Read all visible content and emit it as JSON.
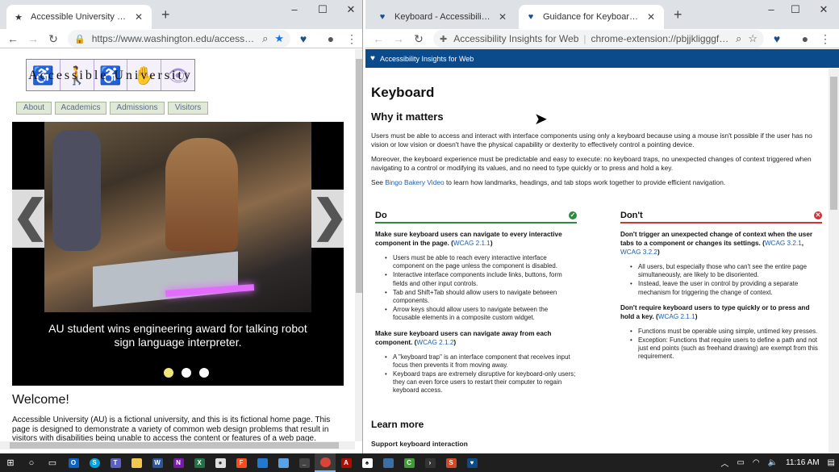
{
  "left_window": {
    "tab_title": "Accessible University Demo Site",
    "url": "https://www.washington.edu/accessco...",
    "page": {
      "logo_text": "Accessible University",
      "nav": [
        "About",
        "Academics",
        "Admissions",
        "Visitors"
      ],
      "carousel": {
        "prev": "❮",
        "next": "❯",
        "caption": "AU student wins engineering award for talking robot sign language interpreter.",
        "slide_count": 3,
        "active_slide": 1
      },
      "heading": "Welcome!",
      "intro": "Accessible University (AU) is a fictional university, and this is its fictional home page. This page is designed to demonstrate a variety of common web design problems that result in visitors with disabilities being unable to access the content or features of a web page. Although the heading at the"
    }
  },
  "right_window": {
    "tabs": [
      {
        "title": "Keyboard - Accessibility Insights f",
        "icon": "heart-icon"
      },
      {
        "title": "Guidance for Keyboard - Accessib",
        "icon": "heart-icon"
      }
    ],
    "omnibox_label": "Accessibility Insights for Web",
    "url": "chrome-extension://pbjjkligggfmak...",
    "extension_bar": "Accessibility Insights for Web",
    "page": {
      "title": "Keyboard",
      "why_heading": "Why it matters",
      "why_p1": "Users must be able to access and interact with interface components using only a keyboard because using a mouse isn't possible if the user has no vision or low vision or doesn't have the physical capability or dexterity to effectively control a pointing device.",
      "why_p2": "Moreover, the keyboard experience must be predictable and easy to execute: no keyboard traps, no unexpected changes of context triggered when navigating to a control or modifying its values, and no need to type quickly or to press and hold a key.",
      "why_p3_before": "See ",
      "why_p3_link": "Bingo Bakery Video",
      "why_p3_after": " to learn how landmarks, headings, and tab stops work together to provide efficient navigation.",
      "do": {
        "heading": "Do",
        "b1_text": "Make sure keyboard users can navigate to every interactive component in the page.",
        "b1_link": "WCAG 2.1.1",
        "b1_items": [
          "Users must be able to reach every interactive interface component on the page unless the component is disabled.",
          "Interactive interface components include links, buttons, form fields and other input controls.",
          "Tab and Shift+Tab should allow users to navigate between components.",
          "Arrow keys should allow users to navigate between the focusable elements in a composite custom widget."
        ],
        "b2_text": "Make sure keyboard users can navigate away from each component.",
        "b2_link": "WCAG 2.1.2",
        "b2_items": [
          "A \"keyboard trap\" is an interface component that receives input focus then prevents it from moving away.",
          "Keyboard traps are extremely disruptive for keyboard-only users; they can even force users to restart their computer to regain keyboard access."
        ]
      },
      "dont": {
        "heading": "Don't",
        "b1_text": "Don't trigger an unexpected change of context when the user tabs to a component or changes its settings.",
        "b1_link1": "WCAG 3.2.1",
        "b1_link2": "WCAG 3.2.2",
        "b1_items": [
          "All users, but especially those who can't see the entire page simultaneously, are likely to be disoriented.",
          "Instead, leave the user in control by providing a separate mechanism for triggering the change of context."
        ],
        "b2_text": "Don't require keyboard users to type quickly or to press and hold a key.",
        "b2_link": "WCAG 2.1.1",
        "b2_items": [
          "Functions must be operable using simple, untimed key presses.",
          "Exception: Functions that require users to define a path and not just end points (such as freehand drawing) are exempt from this requirement."
        ]
      },
      "learn_more": "Learn more",
      "support": "Support keyboard interaction"
    }
  },
  "taskbar": {
    "time": "11:16 AM",
    "apps": [
      "start",
      "search",
      "task-view",
      "outlook",
      "skype",
      "teams",
      "file-explorer",
      "word",
      "onenote",
      "excel",
      "paint",
      "figma",
      "photos",
      "image",
      "console",
      "chrome",
      "acrobat",
      "solitaire",
      "screen",
      "camtasia",
      "code",
      "powerpoint",
      "insights"
    ]
  },
  "colors": {
    "do_accent": "#2b8a3e",
    "dont_accent": "#d13438",
    "insights_blue": "#0b4a8b",
    "link": "#1a5fb4"
  }
}
